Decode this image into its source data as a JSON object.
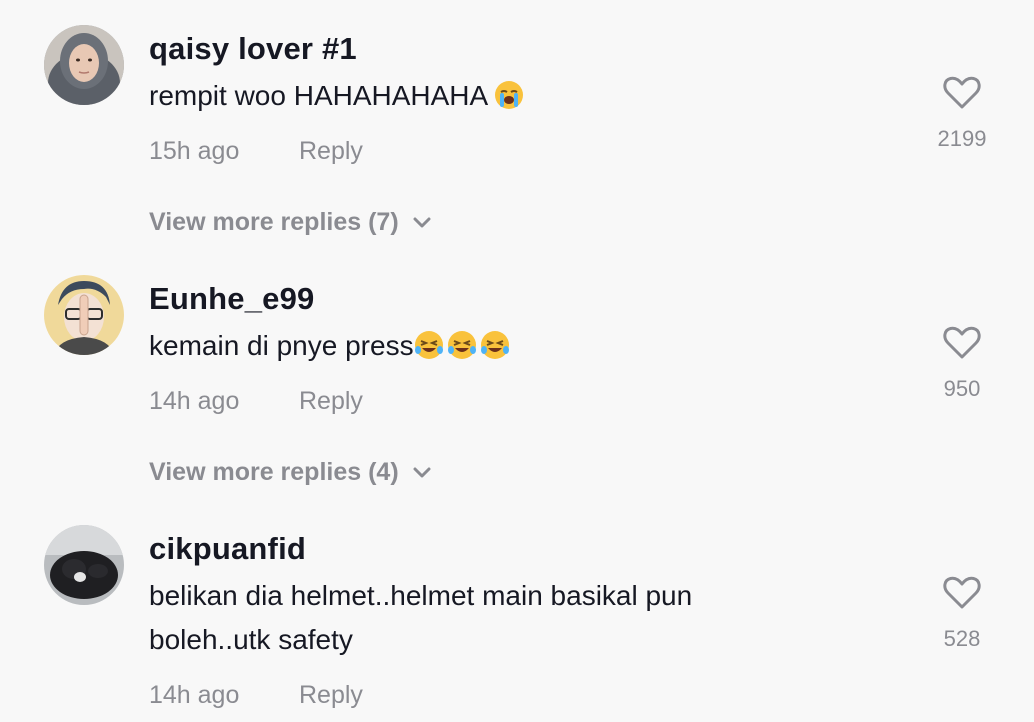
{
  "comments": [
    {
      "username": "qaisy lover #1",
      "text": "rempit woo HAHAHAHAHA",
      "emoji": "loudly-crying-face",
      "time": "15h ago",
      "reply_label": "Reply",
      "likes": "2199",
      "view_more": "View more replies (7)"
    },
    {
      "username": "Eunhe_e99",
      "text": "kemain di pnye press",
      "emoji": "face-with-tears-of-joy x3",
      "time": "14h ago",
      "reply_label": "Reply",
      "likes": "950",
      "view_more": "View more replies (4)"
    },
    {
      "username": "cikpuanfid",
      "text_line1": "belikan dia helmet..helmet main basikal pun",
      "text_line2": "boleh..utk safety",
      "time": "14h ago",
      "reply_label": "Reply",
      "likes": "528"
    }
  ],
  "colors": {
    "background": "#f8f8f8",
    "primary_text": "#161823",
    "secondary_text": "#8a8b91"
  }
}
